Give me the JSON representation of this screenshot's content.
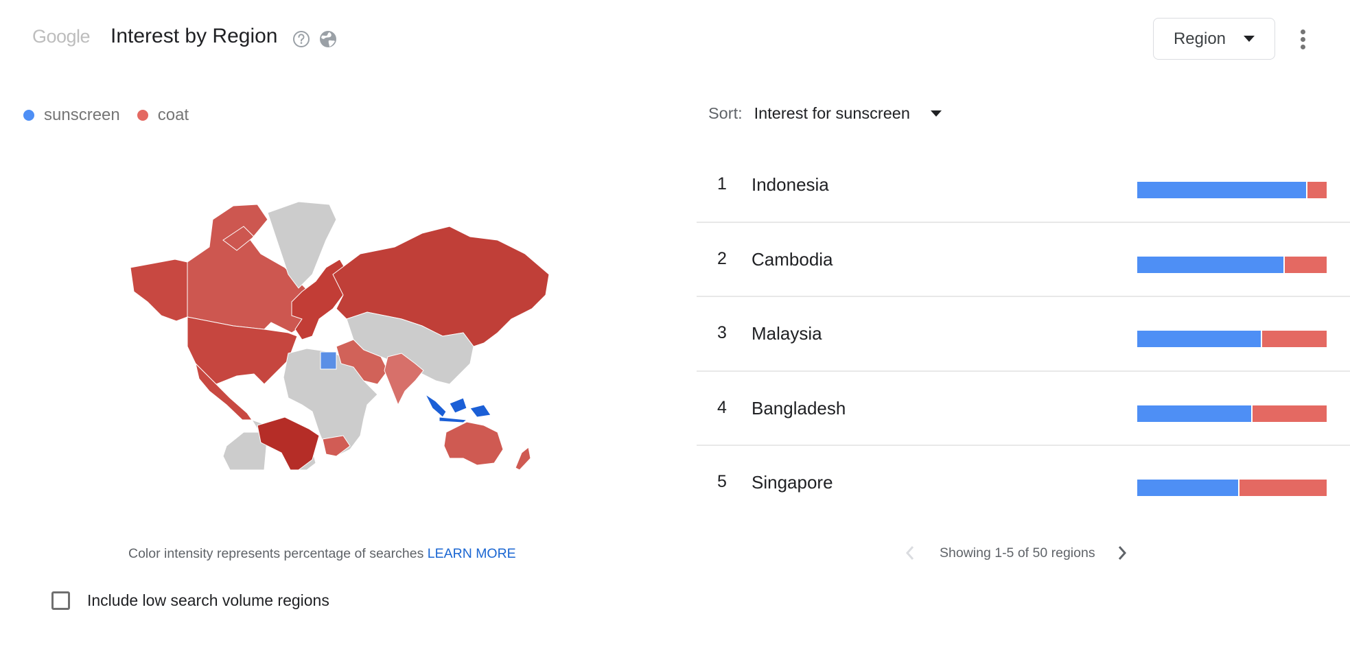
{
  "header": {
    "logo": "Google",
    "title": "Interest by Region",
    "help_icon": "help-circle-icon",
    "globe_icon": "globe-icon",
    "resolution_dropdown": {
      "selected": "Region"
    },
    "more_icon": "more-vert-icon"
  },
  "colors": {
    "sunscreen": "#4e8ff5",
    "coat": "#e46962",
    "no_data": "#cccccc"
  },
  "legend": [
    {
      "label": "sunscreen",
      "color": "#4e8ff5"
    },
    {
      "label": "coat",
      "color": "#e46962"
    }
  ],
  "map": {
    "regions": [
      {
        "name": "Alaska/USA",
        "winner": "coat",
        "shade": "#c84841"
      },
      {
        "name": "Canada",
        "winner": "coat",
        "shade": "#cd5750"
      },
      {
        "name": "United States",
        "winner": "coat",
        "shade": "#c6463f"
      },
      {
        "name": "Mexico",
        "winner": "coat",
        "shade": "#c84841"
      },
      {
        "name": "Greenland",
        "winner": "none",
        "shade": "#cccccc"
      },
      {
        "name": "Central & South America",
        "winner": "none",
        "shade": "#cccccc"
      },
      {
        "name": "Brazil",
        "winner": "coat",
        "shade": "#b52d27"
      },
      {
        "name": "Europe",
        "winner": "coat",
        "shade": "#c23d36"
      },
      {
        "name": "Russia",
        "winner": "coat",
        "shade": "#c03f38"
      },
      {
        "name": "Central & East Asia",
        "winner": "none",
        "shade": "#cccccc"
      },
      {
        "name": "Africa",
        "winner": "none",
        "shade": "#cccccc"
      },
      {
        "name": "Egypt",
        "winner": "sunscreen",
        "shade": "#5a8fe6"
      },
      {
        "name": "Middle East",
        "winner": "coat",
        "shade": "#d16259"
      },
      {
        "name": "India",
        "winner": "coat",
        "shade": "#d7706a"
      },
      {
        "name": "South Africa",
        "winner": "coat",
        "shade": "#d15c55"
      },
      {
        "name": "Indonesia",
        "winner": "sunscreen",
        "shade": "#1b5fd6"
      },
      {
        "name": "Australia",
        "winner": "coat",
        "shade": "#cf5a52"
      },
      {
        "name": "New Zealand",
        "winner": "coat",
        "shade": "#cf5a52"
      }
    ]
  },
  "map_note": {
    "text": "Color intensity represents percentage of searches",
    "link": "LEARN MORE"
  },
  "low_volume_checkbox": {
    "label": "Include low search volume regions",
    "checked": false
  },
  "sort": {
    "label": "Sort:",
    "value": "Interest for sunscreen"
  },
  "rankings": [
    {
      "rank": "1",
      "name": "Indonesia",
      "sunscreen_pct": 90,
      "coat_pct": 10
    },
    {
      "rank": "2",
      "name": "Cambodia",
      "sunscreen_pct": 78,
      "coat_pct": 22
    },
    {
      "rank": "3",
      "name": "Malaysia",
      "sunscreen_pct": 66,
      "coat_pct": 34
    },
    {
      "rank": "4",
      "name": "Bangladesh",
      "sunscreen_pct": 61,
      "coat_pct": 39
    },
    {
      "rank": "5",
      "name": "Singapore",
      "sunscreen_pct": 54,
      "coat_pct": 46
    }
  ],
  "pagination": {
    "text": "Showing 1-5 of 50 regions",
    "prev_icon": "chevron-left-icon",
    "next_icon": "chevron-right-icon"
  }
}
